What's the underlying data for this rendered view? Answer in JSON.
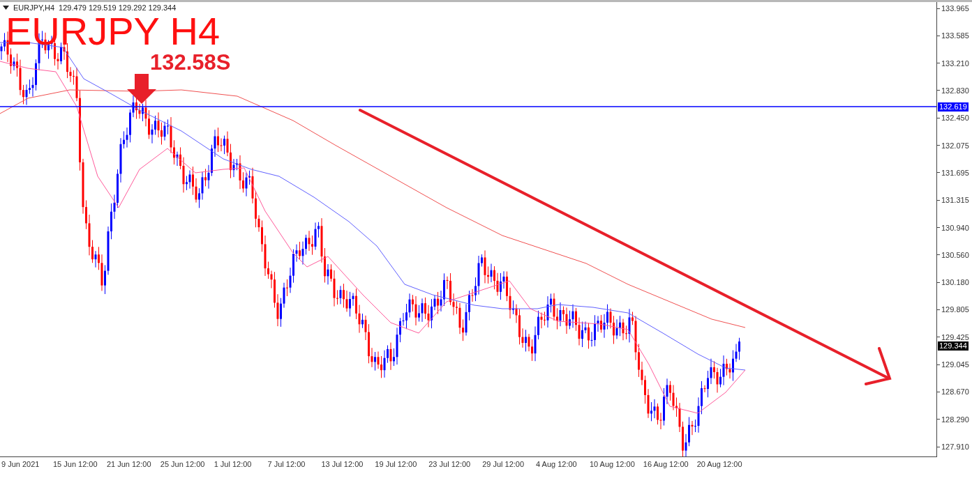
{
  "header": {
    "symbol": "EURJPY,H4",
    "quotes": "129.479 129.519 129.292 129.344"
  },
  "title": "EURJPY H4",
  "level_label": "132.58S",
  "price_axis": [
    "133.965",
    "133.585",
    "133.210",
    "132.830",
    "132.450",
    "132.075",
    "131.695",
    "131.315",
    "130.940",
    "130.560",
    "130.180",
    "129.805",
    "129.425",
    "129.045",
    "128.670",
    "128.290",
    "127.910"
  ],
  "price_tags": [
    {
      "kind": "line",
      "value": "132.619"
    },
    {
      "kind": "bid",
      "value": "129.344"
    }
  ],
  "time_axis": [
    "9 Jun 2021",
    "15 Jun 12:00",
    "21 Jun 12:00",
    "25 Jun 12:00",
    "1 Jul 12:00",
    "7 Jul 12:00",
    "13 Jul 12:00",
    "19 Jul 12:00",
    "23 Jul 12:00",
    "29 Jul 12:00",
    "4 Aug 12:00",
    "10 Aug 12:00",
    "16 Aug 12:00",
    "20 Aug 12:00"
  ]
}
